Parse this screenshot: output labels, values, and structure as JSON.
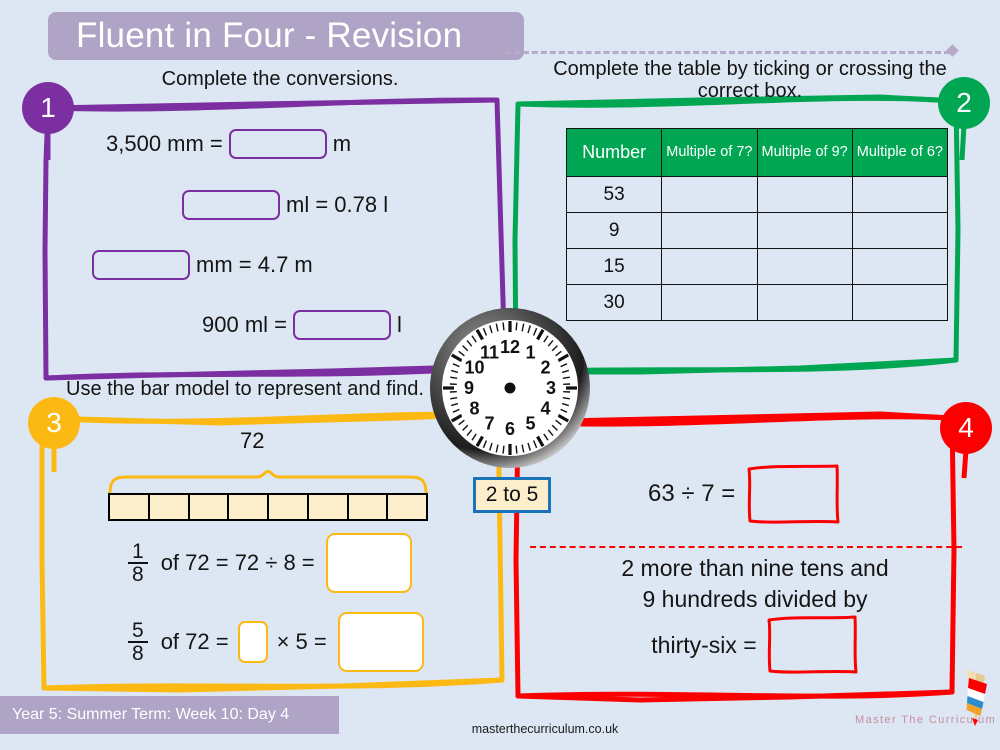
{
  "header": {
    "title": "Fluent in Four - Revision"
  },
  "panels": {
    "one": {
      "badge": "1",
      "prompt": "Complete the conversions.",
      "accent": "#7c2fa0",
      "rows": [
        {
          "before": "3,500 mm =",
          "after": "m"
        },
        {
          "before": "",
          "after": "ml = 0.78 l"
        },
        {
          "before": "",
          "after": "mm = 4.7 m"
        },
        {
          "before": "900 ml =",
          "after": "l"
        }
      ]
    },
    "two": {
      "badge": "2",
      "prompt": "Complete the table by ticking or crossing the correct box.",
      "accent": "#00a651",
      "table": {
        "headers": [
          "Number",
          "Multiple of 7?",
          "Multiple of 9?",
          "Multiple of 6?"
        ],
        "rows": [
          {
            "number": "53",
            "m7": "",
            "m9": "",
            "m6": ""
          },
          {
            "number": "9",
            "m7": "",
            "m9": "",
            "m6": ""
          },
          {
            "number": "15",
            "m7": "",
            "m9": "",
            "m6": ""
          },
          {
            "number": "30",
            "m7": "",
            "m9": "",
            "m6": ""
          }
        ]
      }
    },
    "three": {
      "badge": "3",
      "prompt": "Use the bar model to represent and find.",
      "accent": "#fcb913",
      "bar_total": "72",
      "bar_segments": 8,
      "equations": [
        {
          "numerator": "1",
          "denominator": "8",
          "text_a": "of 72 = 72 ÷ 8 =",
          "has_small_box": false,
          "text_b": ""
        },
        {
          "numerator": "5",
          "denominator": "8",
          "text_a": "of 72 =",
          "has_small_box": true,
          "text_b": "× 5 ="
        }
      ]
    },
    "four": {
      "badge": "4",
      "accent": "#fb0000",
      "division": "63 ÷ 7 =",
      "word_problem": {
        "line1": "2 more than nine tens and",
        "line2": "9 hundreds divided by",
        "line3": "thirty-six ="
      }
    }
  },
  "clock": {
    "numerals": [
      "12",
      "1",
      "2",
      "3",
      "4",
      "5",
      "6",
      "7",
      "8",
      "9",
      "10",
      "11"
    ],
    "label": "2 to 5"
  },
  "footer": {
    "term_label": "Year 5: Summer Term: Week 10: Day 4",
    "url": "masterthecurriculum.co.uk",
    "brand": "Master The Curriculum"
  }
}
